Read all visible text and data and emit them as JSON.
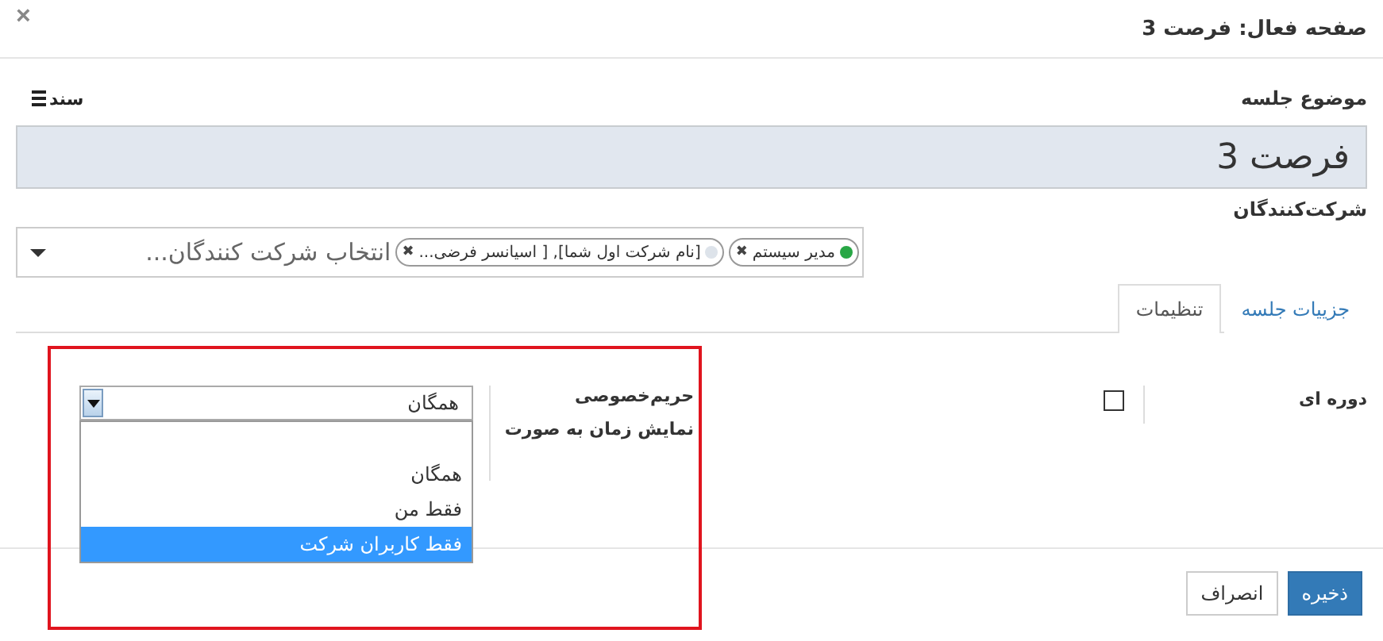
{
  "dialog": {
    "title": "صفحه فعال: فرصت 3",
    "close": "×"
  },
  "subject": {
    "label": "موضوع جلسه",
    "value": "فرصت 3",
    "document_link": "سند"
  },
  "attendees": {
    "label": "شرکت‌کنندگان",
    "placeholder": "انتخاب شرکت کنندگان...",
    "tags": [
      {
        "text": "مدیر سیستم",
        "color": "#28a745",
        "remove": "✖"
      },
      {
        "text": "[نام شرکت اول شما], [ اسیانسر فرضی...",
        "color": "#dde3ea",
        "remove": "✖"
      }
    ]
  },
  "tabs": [
    {
      "label": "جزییات جلسه",
      "selected": false
    },
    {
      "label": "تنظیمات",
      "selected": true
    }
  ],
  "settings": {
    "recurrent": {
      "label": "دوره ای",
      "checked": false
    },
    "privacy": {
      "label": "حریم‌خصوصی",
      "value": "همگان",
      "expanded": true,
      "options": [
        {
          "text": "همگان",
          "highlighted": false
        },
        {
          "text": "فقط من",
          "highlighted": false
        },
        {
          "text": "فقط کاربران شرکت",
          "highlighted": true
        }
      ]
    },
    "show_time_as": {
      "label": "نمایش زمان به صورت"
    }
  },
  "buttons": [
    {
      "label": "ذخیره",
      "kind": "primary"
    },
    {
      "label": "انصراف",
      "kind": "default"
    }
  ],
  "annotation": {
    "shown": true
  }
}
